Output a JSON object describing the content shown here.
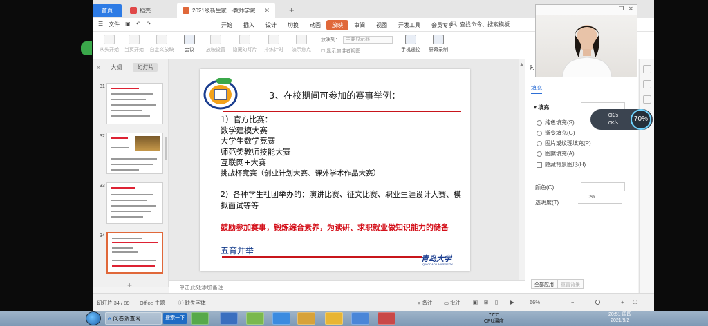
{
  "tabs": {
    "home": "首页",
    "daoke": "稻壳",
    "doc": "2021级新生家...-教师学院家长会",
    "new_tab": "+"
  },
  "menu": {
    "file": "文件",
    "items": [
      "开始",
      "插入",
      "设计",
      "切换",
      "动画",
      "放映",
      "审阅",
      "视图",
      "开发工具",
      "会员专享"
    ],
    "active": "放映",
    "search": "查找命令、搜索模板"
  },
  "ribbon": {
    "tools": [
      "从头开始",
      "当页开始",
      "自定义放映",
      "会议",
      "放映设置",
      "隐藏幻灯片",
      "排练计时",
      "演示焦点"
    ],
    "switch_label": "放映到：",
    "switch_value": "主要显示器",
    "presenter_check": "显示演讲者视图",
    "phone_remote": "手机遥控",
    "screen_record": "屏幕录制"
  },
  "left_pane": {
    "outline_tab": "大纲",
    "slides_tab": "幻灯片",
    "thumbnails": [
      {
        "num": "31"
      },
      {
        "num": "32"
      },
      {
        "num": "33"
      },
      {
        "num": "34",
        "selected": true
      }
    ],
    "add": "+"
  },
  "slide": {
    "title": "3、在校期间可参加的赛事举例：",
    "official_heading": "1）官方比赛：",
    "official_items": [
      "数学建模大赛",
      "大学生数学竞赛",
      "师范类教师技能大赛",
      "互联网+大赛",
      "挑战杯竞赛（创业计划大赛、课外学术作品大赛）"
    ],
    "societies": "2）各种学生社团举办的：演讲比赛、征文比赛、职业生涯设计大赛、模拟面试等等",
    "encourage": "鼓励参加赛事，锻炼综合素养，为读研、求职就业做知识能力的储备",
    "five_edu": "五育并举",
    "university": "青岛大学",
    "university_en": "QINGDAO UNIVERSITY"
  },
  "notes_placeholder": "单击此处添加备注",
  "right_pane": {
    "header": "对象属性",
    "tab": "填充",
    "section": "填充",
    "options": [
      "纯色填充(S)",
      "渐变填充(G)",
      "图片或纹理填充(P)",
      "图案填充(A)"
    ],
    "hide_bg": "隐藏背景图形(H)",
    "color_label": "颜色(C)",
    "transparency_label": "透明度(T)",
    "transparency_value": "0%",
    "apply_all": "全部应用",
    "reset_bg": "重置背景"
  },
  "speed_widget": {
    "up": "0K/s",
    "down": "0K/s",
    "percent": "70%"
  },
  "status_bar": {
    "slide_counter": "幻灯片 34 / 89",
    "theme": "Office 主题",
    "missing_font": "缺失字体",
    "notes": "备注",
    "comments": "批注",
    "zoom": "66%",
    "zoom_level": 0.66
  },
  "taskbar": {
    "browser_label": "问卷调查网",
    "search_btn": "搜索一下",
    "tray_temp": "77°C",
    "tray_cpu": "CPU温度",
    "time": "20:51 周四",
    "date": "2021/9/2"
  },
  "colors": {
    "accent_orange": "#e0683a",
    "home_blue": "#2d7be5",
    "slide_red": "#d4101a",
    "slide_blue": "#123a8a"
  }
}
